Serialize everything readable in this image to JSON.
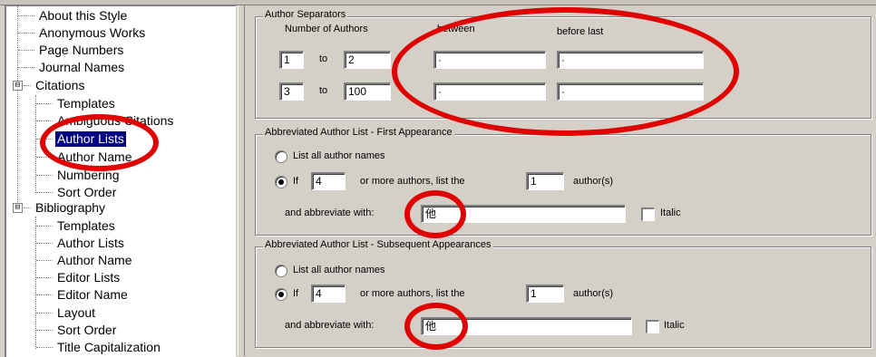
{
  "tree": {
    "items": [
      {
        "label": "About this Style"
      },
      {
        "label": "Anonymous Works"
      },
      {
        "label": "Page Numbers"
      },
      {
        "label": "Journal Names"
      },
      {
        "label": "Citations",
        "expander": "⊟"
      },
      {
        "label": "Templates"
      },
      {
        "label": "Ambiguous Citations"
      },
      {
        "label": "Author Lists"
      },
      {
        "label": "Author Name"
      },
      {
        "label": "Numbering"
      },
      {
        "label": "Sort Order"
      },
      {
        "label": "Bibliography",
        "expander": "⊟"
      },
      {
        "label": "Templates"
      },
      {
        "label": "Author Lists"
      },
      {
        "label": "Author Name"
      },
      {
        "label": "Editor Lists"
      },
      {
        "label": "Editor Name"
      },
      {
        "label": "Layout"
      },
      {
        "label": "Sort Order"
      },
      {
        "label": "Title Capitalization"
      }
    ],
    "selected": "Author Lists"
  },
  "separators": {
    "title": "Author Separators",
    "num_authors_label": "Number of Authors",
    "between_label": "between",
    "before_last_label": "before last",
    "to_label": "to",
    "rows": [
      {
        "from": "1",
        "to": "2",
        "between": "·",
        "before_last": "·"
      },
      {
        "from": "3",
        "to": "100",
        "between": "·",
        "before_last": "·"
      }
    ]
  },
  "first": {
    "title": "Abbreviated Author List - First Appearance",
    "list_all": "List all author names",
    "if_label": "If",
    "more_text": "or more authors, list the",
    "count": "4",
    "list_count": "1",
    "authors_text": "author(s)",
    "abbrev_label": "and abbreviate with:",
    "abbrev_value": "他",
    "italic_label": "Italic"
  },
  "subsequent": {
    "title": "Abbreviated Author List - Subsequent Appearances",
    "list_all": "List all author names",
    "if_label": "If",
    "more_text": "or more authors, list the",
    "count": "4",
    "list_count": "1",
    "authors_text": "author(s)",
    "abbrev_label": "and abbreviate with:",
    "abbrev_value": "他",
    "italic_label": "Italic"
  },
  "colors": {
    "highlight": "#e00000",
    "selection": "#000080"
  }
}
